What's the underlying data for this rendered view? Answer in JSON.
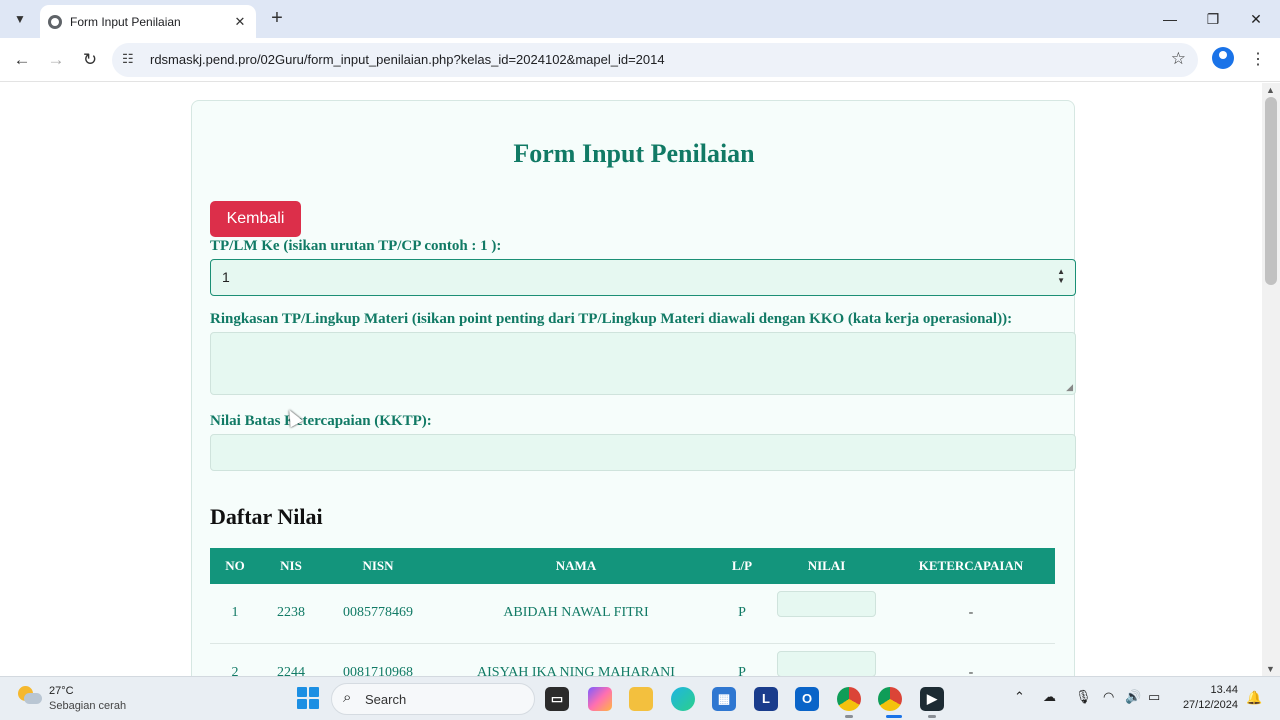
{
  "browser": {
    "tab_title": "Form Input Penilaian",
    "new_tab_symbol": "+",
    "url": "rdsmaskj.pend.pro/02Guru/form_input_penilaian.php?kelas_id=2024102&mapel_id=2014"
  },
  "form": {
    "title": "Form Input Penilaian",
    "back_button": "Kembali",
    "tp_label": "TP/LM Ke (isikan urutan TP/CP contoh : 1 ):",
    "tp_value": "1",
    "ringkasan_label": "Ringkasan TP/Lingkup Materi (isikan point penting dari TP/Lingkup Materi diawali dengan KKO (kata kerja operasional)):",
    "ringkasan_value": "",
    "kktp_label": "Nilai Batas Ketercapaian (KKTP):",
    "kktp_value": ""
  },
  "daftar": {
    "title": "Daftar Nilai",
    "headers": [
      "NO",
      "NIS",
      "NISN",
      "NAMA",
      "L/P",
      "NILAI",
      "KETERCAPAIAN"
    ],
    "rows": [
      {
        "no": "1",
        "nis": "2238",
        "nisn": "0085778469",
        "nama": "ABIDAH NAWAL FITRI",
        "lp": "P",
        "nilai": "",
        "ketercapaian": "-"
      },
      {
        "no": "2",
        "nis": "2244",
        "nisn": "0081710968",
        "nama": "AISYAH IKA NING MAHARANI",
        "lp": "P",
        "nilai": "",
        "ketercapaian": "-"
      }
    ]
  },
  "taskbar": {
    "weather_temp": "27°C",
    "weather_desc": "Sebagian cerah",
    "search_placeholder": "Search",
    "time": "13.44",
    "date": "27/12/2024"
  },
  "colors": {
    "accent": "#117a65",
    "table_header": "#13957c",
    "danger_button": "#dc2f4a",
    "field_bg": "#e6f8f1"
  },
  "icons": {
    "taskbar_apps": [
      "file-explorer-icon",
      "copilot-icon",
      "folder-icon",
      "edge-icon",
      "store-icon",
      "l-app-icon",
      "outlook-icon",
      "chrome-icon",
      "chrome-active-icon",
      "terminal-icon"
    ]
  }
}
